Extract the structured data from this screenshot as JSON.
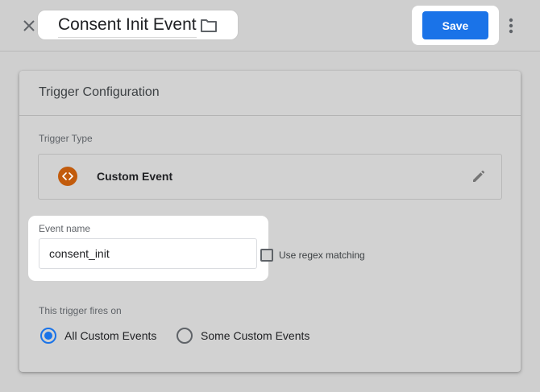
{
  "header": {
    "title": "Consent Init Event",
    "save_label": "Save",
    "icons": {
      "close": "close-icon",
      "folder": "folder-icon",
      "more": "more-vert-icon"
    }
  },
  "card": {
    "title": "Trigger Configuration",
    "trigger_type_label": "Trigger Type",
    "trigger_type": {
      "name": "Custom Event",
      "icon": "custom-event-icon",
      "icon_color": "#c25b0c"
    },
    "event_name_label": "Event name",
    "event_name_value": "consent_init",
    "regex_label": "Use regex matching",
    "regex_checked": false,
    "fires_on_label": "This trigger fires on",
    "fires_on_options": [
      {
        "label": "All Custom Events",
        "selected": true
      },
      {
        "label": "Some Custom Events",
        "selected": false
      }
    ]
  },
  "colors": {
    "accent": "#1a73e8",
    "background": "#cfcfcf",
    "highlight": "#ffffff"
  }
}
